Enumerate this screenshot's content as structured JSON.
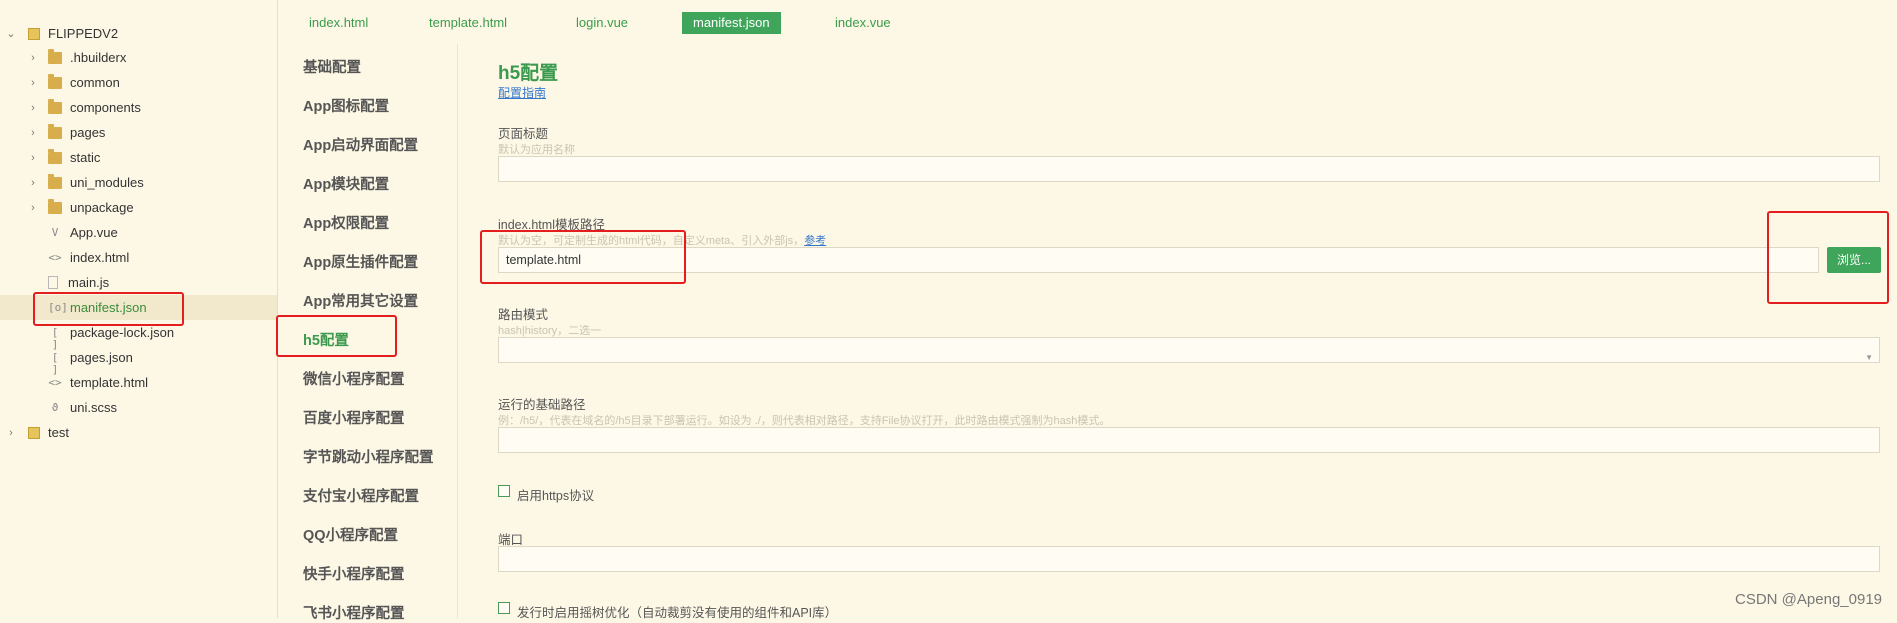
{
  "file_tree": {
    "root": "FLIPPEDV2",
    "items": [
      {
        "label": ".hbuilderx",
        "icon": "folder-icon"
      },
      {
        "label": "common",
        "icon": "folder-icon"
      },
      {
        "label": "components",
        "icon": "folder-icon"
      },
      {
        "label": "pages",
        "icon": "folder-icon"
      },
      {
        "label": "static",
        "icon": "folder-icon"
      },
      {
        "label": "uni_modules",
        "icon": "folder-icon"
      },
      {
        "label": "unpackage",
        "icon": "folder-icon"
      },
      {
        "label": "App.vue",
        "icon": "vue-file-icon"
      },
      {
        "label": "index.html",
        "icon": "html-file-icon"
      },
      {
        "label": "main.js",
        "icon": "js-file-icon"
      },
      {
        "label": "manifest.json",
        "icon": "json-file-icon"
      },
      {
        "label": "package-lock.json",
        "icon": "json-file-icon"
      },
      {
        "label": "pages.json",
        "icon": "json-file-icon"
      },
      {
        "label": "template.html",
        "icon": "html-file-icon"
      },
      {
        "label": "uni.scss",
        "icon": "scss-file-icon"
      }
    ],
    "second_project": "test"
  },
  "tabs": [
    {
      "label": "index.html"
    },
    {
      "label": "template.html"
    },
    {
      "label": "login.vue"
    },
    {
      "label": "manifest.json"
    },
    {
      "label": "index.vue"
    }
  ],
  "settings_nav": [
    "基础配置",
    "App图标配置",
    "App启动界面配置",
    "App模块配置",
    "App权限配置",
    "App原生插件配置",
    "App常用其它设置",
    "h5配置",
    "微信小程序配置",
    "百度小程序配置",
    "字节跳动小程序配置",
    "支付宝小程序配置",
    "QQ小程序配置",
    "快手小程序配置",
    "飞书小程序配置"
  ],
  "content": {
    "title": "h5配置",
    "guide_link": "配置指南",
    "page_title": {
      "label": "页面标题",
      "hint": "默认为应用名称",
      "value": ""
    },
    "template_path": {
      "label": "index.html模板路径",
      "hint": "默认为空，可定制生成的html代码，自定义meta、引入外部js，",
      "hint_link": "参考",
      "value": "template.html",
      "browse_label": "浏览..."
    },
    "router_mode": {
      "label": "路由模式",
      "hint": "hash|history，二选一",
      "value": ""
    },
    "base_path": {
      "label": "运行的基础路径",
      "hint": "例：/h5/，代表在域名的/h5目录下部署运行。如设为 ./，则代表相对路径，支持File协议打开，此时路由模式强制为hash模式。",
      "value": ""
    },
    "https": {
      "label": "启用https协议",
      "checked": false
    },
    "port": {
      "label": "端口",
      "value": ""
    },
    "tree_shaking": {
      "label": "发行时启用摇树优化（自动裁剪没有使用的组件和API库）",
      "checked": false
    }
  },
  "watermark": "CSDN @Apeng_0919",
  "colors": {
    "accent": "#3fa55a",
    "highlight": "#e41e1e",
    "background": "#fdf8e6"
  }
}
